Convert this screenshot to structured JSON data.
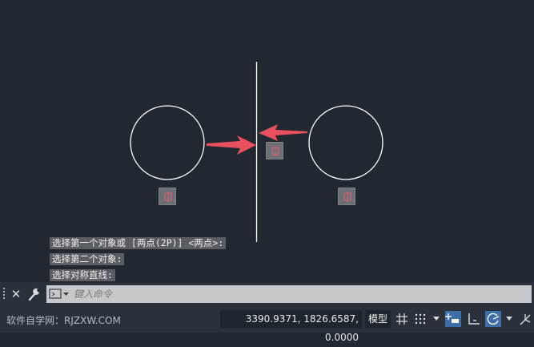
{
  "command_history": [
    "选择第一个对象或 [两点(2P)] <两点>:",
    "选择第二个对象:",
    "选择对称直线:"
  ],
  "command_line": {
    "placeholder": "键入命令",
    "close_icon": "close-icon",
    "customize_icon": "wrench-icon",
    "prompt_icon": "command-prompt-icon"
  },
  "status_bar": {
    "watermark": "软件自学网：RJZXW.COM",
    "coordinates": "3390.9371, 1826.6587, 0.0000",
    "model_tab": "模型",
    "icons": [
      "grid-icon",
      "snap-mode-icon",
      "infer-constraints-icon",
      "ortho-mode-icon",
      "polar-tracking-icon",
      "isodraft-icon"
    ]
  },
  "colors": {
    "canvas_bg": "#212830",
    "arrow": "#e8505f",
    "geometry": "#ffffff"
  }
}
